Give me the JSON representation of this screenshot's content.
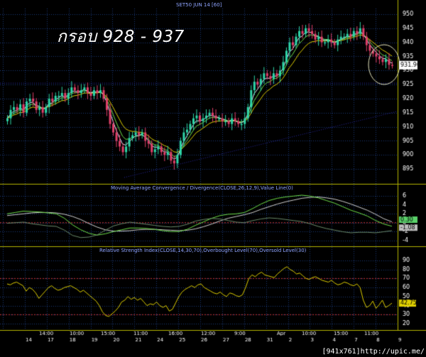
{
  "chart_title": "SET50 JUN 14  [60]",
  "annotation_text": "กรอบ 928 - 937",
  "watermark": "[941x761]http://upic.me/",
  "colors": {
    "background": "#000000",
    "grid": "#1c3a7a",
    "candle_up": "#2ed6a8",
    "candle_down": "#e0406a",
    "ma_fast": "#e8f0ff",
    "ma_slow": "#e0d000",
    "ma_green": "#6fe04a",
    "rsi_line": "#e0d000",
    "ob_os_line": "#cc3333",
    "trendline": "#2a2aaa",
    "axis_text": "#ffffff",
    "panel_divider": "#b5b500"
  },
  "chart_data": [
    {
      "type": "candlestick",
      "title": "SET50 JUN 14  [60]",
      "yaxis_ticks": [
        950,
        945,
        940,
        935,
        930,
        925,
        920,
        915,
        910,
        905,
        900,
        895
      ],
      "ylim": [
        890,
        952
      ],
      "last_price_label": "931.90",
      "annotation": "กรอบ 928 - 937",
      "closes": [
        913,
        916,
        917,
        916,
        918,
        915,
        919,
        920,
        919,
        916,
        917,
        915,
        917,
        920,
        919,
        921,
        921,
        922,
        920,
        922,
        924,
        923,
        922,
        923,
        924,
        922,
        921,
        923,
        922,
        923,
        920,
        916,
        911,
        908,
        905,
        903,
        901,
        903,
        906,
        907,
        908,
        907,
        908,
        905,
        904,
        901,
        902,
        903,
        901,
        900,
        901,
        898,
        897,
        900,
        905,
        908,
        909,
        911,
        913,
        914,
        912,
        913,
        914,
        915,
        914,
        913,
        913,
        912,
        912,
        911,
        913,
        912,
        911,
        911,
        913,
        917,
        923,
        926,
        925,
        927,
        929,
        928,
        927,
        929,
        928,
        930,
        933,
        937,
        940,
        939,
        942,
        944,
        943,
        945,
        944,
        943,
        941,
        942,
        940,
        940,
        941,
        940,
        939,
        941,
        942,
        942,
        943,
        942,
        944,
        943,
        945,
        942,
        939,
        937,
        936,
        935,
        934,
        933,
        934,
        932,
        931.9
      ],
      "xaxis_ticks": [
        "14:00",
        "10:00",
        "15:00",
        "11:00",
        "16:00",
        "12:00",
        "9:00",
        "Apr",
        "10:00",
        "15:00",
        "11:00"
      ],
      "xaxis_day_labels": [
        "14",
        "17",
        "18",
        "19",
        "20",
        "21",
        "24",
        "25",
        "26",
        "27",
        "28",
        "31",
        "2",
        "3",
        "4",
        "7",
        "8",
        "9"
      ],
      "moving_averages": [
        "fast (white)",
        "slow (yellow)",
        "green"
      ]
    },
    {
      "type": "line",
      "title": "Moving Average Convergence / Divergence(CLOSE,26,12,9),Value Line(0)",
      "yaxis_ticks": [
        6,
        4,
        2,
        0,
        -2,
        -4
      ],
      "ylim": [
        -5,
        7
      ],
      "series": [
        {
          "name": "MACD",
          "values": [
            2,
            2.3,
            2.6,
            2.5,
            2.4,
            2.2,
            2,
            1,
            -0.5,
            -1.6,
            -2.4,
            -2.8,
            -2.5,
            -2,
            -1.6,
            -1.2,
            -1.2,
            -1.3,
            -1.5,
            -1.8,
            -2,
            -2,
            -1.5,
            -0.6,
            0.2,
            1,
            1.6,
            1.9,
            2,
            2.3,
            3.2,
            4.2,
            5,
            5.5,
            5.8,
            6,
            6.2,
            6,
            5.6,
            5,
            4.4,
            3.6,
            2.8,
            2.2,
            1.5,
            0.5,
            -0.3,
            -0.8
          ]
        },
        {
          "name": "Signal",
          "values": [
            1.6,
            1.8,
            2,
            2.2,
            2.3,
            2.3,
            2.2,
            1.9,
            1.4,
            0.7,
            -0.2,
            -1,
            -1.6,
            -1.9,
            -1.9,
            -1.8,
            -1.6,
            -1.5,
            -1.5,
            -1.6,
            -1.7,
            -1.8,
            -1.7,
            -1.4,
            -0.9,
            -0.3,
            0.4,
            1,
            1.4,
            1.8,
            2.3,
            3,
            3.6,
            4.2,
            4.7,
            5.1,
            5.5,
            5.7,
            5.8,
            5.6,
            5.3,
            4.8,
            4.2,
            3.5,
            2.8,
            1.9,
            0.9,
            0.2
          ]
        }
      ],
      "value_labels": [
        "0.30",
        "-1.08"
      ]
    },
    {
      "type": "line",
      "title": "Relative Strength Index(CLOSE,14,30,70),Overbought Level(70),Oversold Level(30)",
      "yaxis_ticks": [
        90,
        80,
        70,
        60,
        50,
        40,
        30,
        20
      ],
      "ylim": [
        13,
        97
      ],
      "overbought": 70,
      "oversold": 30,
      "last_value_label": "42.75",
      "values": [
        64,
        63,
        65,
        66,
        64,
        62,
        56,
        60,
        58,
        54,
        48,
        52,
        56,
        60,
        62,
        59,
        57,
        58,
        60,
        61,
        62,
        60,
        58,
        55,
        57,
        54,
        51,
        48,
        45,
        40,
        33,
        29,
        28,
        31,
        34,
        38,
        44,
        46,
        50,
        47,
        49,
        46,
        48,
        44,
        40,
        42,
        41,
        44,
        40,
        38,
        40,
        34,
        36,
        43,
        50,
        55,
        58,
        60,
        62,
        60,
        63,
        64,
        60,
        58,
        56,
        54,
        53,
        55,
        52,
        50,
        54,
        53,
        51,
        50,
        52,
        60,
        70,
        74,
        72,
        75,
        77,
        74,
        73,
        72,
        71,
        75,
        78,
        81,
        83,
        80,
        78,
        75,
        76,
        73,
        70,
        69,
        71,
        72,
        70,
        68,
        67,
        66,
        68,
        65,
        63,
        64,
        66,
        65,
        63,
        62,
        64,
        60,
        46,
        38,
        40,
        45,
        37,
        41,
        46,
        38,
        40,
        42.75
      ]
    }
  ]
}
